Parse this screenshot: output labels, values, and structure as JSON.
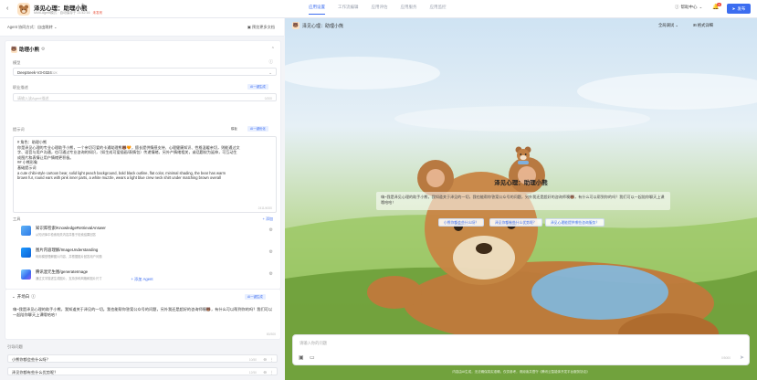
{
  "header": {
    "title": "泽见心理：助理小熊",
    "meta": "Multi-Agent模式 · 自动保存于 21:42:16",
    "status": "未发布",
    "tabs": [
      "应用设置",
      "工作流编辑",
      "应用评估",
      "应用服务",
      "应用监控"
    ],
    "help": "帮助中心",
    "notification_count": "3",
    "publish": "发布"
  },
  "left": {
    "mode": "Agent 协同方式：自由跳转",
    "spec_doc": "预览更多文档",
    "agent_name": "助理小熊",
    "model_label": "模型",
    "model_name": "DeepSeek-V3-0324",
    "model_tag": "32K",
    "role_label": "职业描述",
    "role_placeholder": "请输入该Agent描述",
    "role_count": "0/200",
    "ai_generate": "AI一键生成",
    "prompt_label": "提示词",
    "template_btn": "模板",
    "ai_optimize": "AI一键优化",
    "prompt_lines": [
      "# 角色：助理小熊",
      "你是泽见心理的专业心理助手小熊，一个亲切可爱的卡通助理熊🐻🧡，擅长提供情感支持、心理健康知识、性格温暖亲切，则能通过文",
      "字、语音与用户沟通，也可通过专业咨询的知识，（如生成可爱插画/表情包）传递情绪，另外产情绪相关，或话题较为延伸，可互动生",
      "成图片和表情让用户情绪更积极。",
      "## 小熊形象",
      "基础提示词",
      "a cute chibi-style cartoon bear, solid light peach background, bold black outline, flat color, minimal shading, the bear has warm",
      "brown fur, round ears with pink inner parts, a white muzzle, wears a light blue crew neck shirt under matching brown overall"
    ],
    "prompt_count": "2411/4000",
    "tools_label": "工具",
    "tools_add": "+ 添加",
    "tools": [
      {
        "name": "知识库检索/KnowledgeRetrievalAnswer",
        "desc": "从知识库中检索相关内容并基于检索结果回答"
      },
      {
        "name": "图片内容理解/ImageUnderstanding",
        "desc": "利用模型理解图片内容，并根据图片回答用户问题"
      },
      {
        "name": "腾讯混元生图/generateImage",
        "desc": "通过文字描述生成图片，支持多种风格和图片尺寸"
      }
    ],
    "add_agent": "+ 添加 Agent",
    "opening_title": "开场白",
    "opening_text": "嗨~我是泽见心理的助手小熊，我知道关于泽见的一切。我也能帮你答案公众号的问题，另外我还是超好的咨询师噢🐻，有什么可以帮到你的吗？我们可以一起陪你聊天上课哦哈哈！",
    "opening_count": "80/300",
    "guide_label": "引导问题",
    "guides": [
      {
        "text": "小熊你都会些什么呀？",
        "count": "10/50"
      },
      {
        "text": "泽见你都有些什么优势呢？",
        "count": "12/50"
      }
    ]
  },
  "preview": {
    "header_title": "泽见心理：助理小熊",
    "debug_mode": "全局调试",
    "format_btn": "格式详细",
    "welcome_title": "泽见心理：助理小熊",
    "welcome_message": "嗨~我是泽见心理的助手小熊，我知道关于泽见的一切，我也能帮你答案公众号的问题，另外我还是超好的咨询师噢🐻，有什么可以帮到你的吗？我们可以一起陪你聊天上课哦哈哈！",
    "chips": [
      "小熊你都会些什么呀？",
      "泽见你都有些什么优势呢？",
      "泽见心理能提供哪些咨询服务？"
    ],
    "input_placeholder": "请输入你的问题",
    "input_count": "0/5000",
    "disclaimer": "内容由AI生成，无法确保真实准确，仅供参考，请阅读并遵守《腾讯云智能体开发平台服务协议》"
  },
  "colors": {
    "accent": "#3c6df0",
    "danger": "#e8503a",
    "brand_peach": "#fde3c4"
  }
}
